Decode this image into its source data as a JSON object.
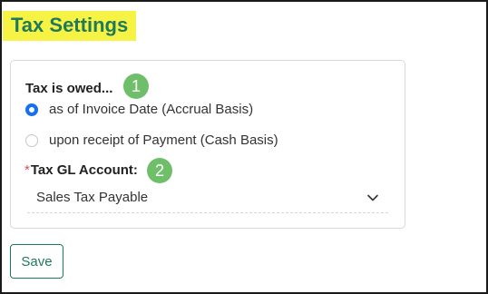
{
  "page": {
    "title": "Tax Settings"
  },
  "form": {
    "tax_owed_label": "Tax is owed...",
    "marker_1": "1",
    "options": [
      {
        "label": "as of Invoice Date (Accrual Basis)",
        "checked": true
      },
      {
        "label": "upon receipt of Payment (Cash Basis)",
        "checked": false
      }
    ],
    "gl_required_mark": "*",
    "gl_label": "Tax GL Account:",
    "marker_2": "2",
    "gl_value": "Sales Tax Payable"
  },
  "actions": {
    "save_label": "Save"
  },
  "colors": {
    "title": "#1f7a5a",
    "highlight": "#f7f345",
    "marker": "#6fbf6a",
    "radio_selected": "#1570ef"
  }
}
